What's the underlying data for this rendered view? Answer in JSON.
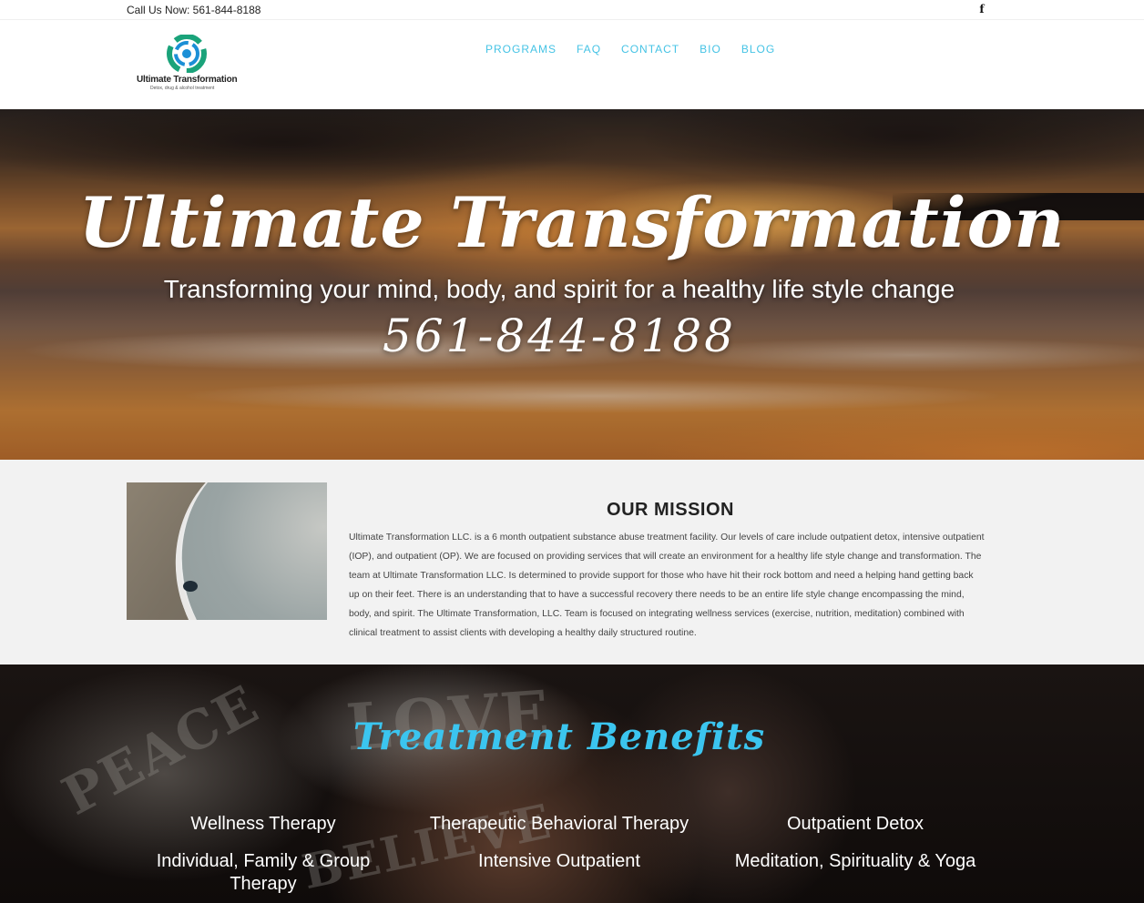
{
  "topbar": {
    "phone": "Call Us Now: 561-844-8188",
    "social_icon": "facebook-icon",
    "social_glyph": "f"
  },
  "logo": {
    "name": "Ultimate Transformation",
    "tagline": "Detox, drug & alcohol treatment",
    "icon": "spiral-emblem-icon",
    "colors": [
      "#1aa37a",
      "#1b8fd6"
    ]
  },
  "nav": {
    "items": [
      "PROGRAMS",
      "FAQ",
      "CONTACT",
      "BIO",
      "BLOG"
    ],
    "color": "#45c3e5"
  },
  "hero": {
    "title": "Ultimate Transformation",
    "subtitle": "Transforming your mind, body, and spirit for a healthy life style change",
    "phone": "561-844-8188"
  },
  "mission": {
    "title": "OUR MISSION",
    "image_alt": "Sea turtle hatchling on beach",
    "text": "Ultimate Transformation LLC. is a 6 month outpatient substance abuse treatment facility. Our levels of care include outpatient detox, intensive outpatient (IOP), and outpatient (OP). We are focused on providing services that will create an environment for a healthy life style change and transformation. The team at Ultimate Transformation LLC. Is determined to provide support for those who have hit their rock bottom and need a helping hand getting back up on their feet. There is an understanding that to have a successful recovery there needs to be an entire life style change encompassing the mind, body, and spirit. The Ultimate Transformation, LLC. Team is focused on integrating wellness services (exercise, nutrition, meditation) combined with clinical treatment to assist clients with developing a healthy daily structured routine."
  },
  "benefits": {
    "title": "Treatment Benefits",
    "title_color": "#3bc5ef",
    "stone_words": [
      "PEACE",
      "LOVE",
      "BELIEVE"
    ],
    "items": [
      "Wellness Therapy",
      "Therapeutic Behavioral Therapy",
      "Outpatient Detox",
      "Individual, Family & Group Therapy",
      "Intensive Outpatient",
      "Meditation, Spirituality & Yoga"
    ]
  }
}
